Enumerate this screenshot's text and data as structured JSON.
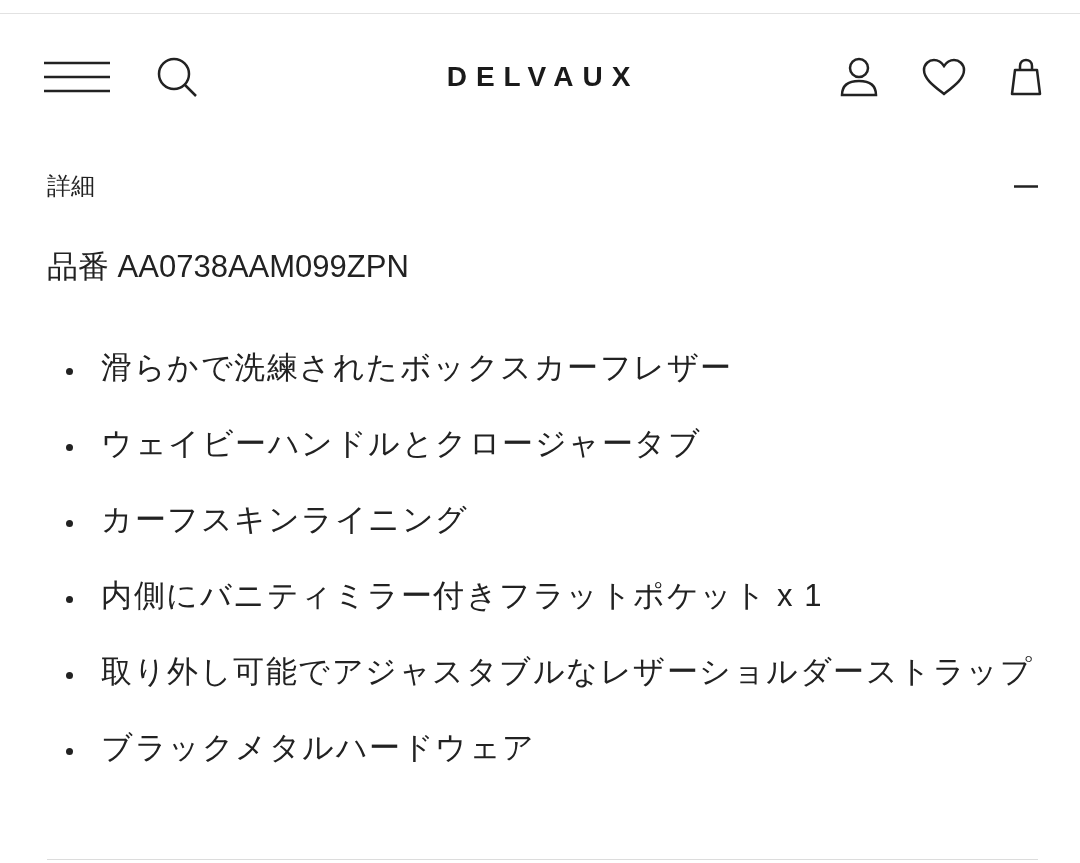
{
  "header": {
    "logo": "DELVAUX"
  },
  "section": {
    "title": "詳細",
    "expanded": true,
    "product_code": "品番 AA0738AAM099ZPN",
    "features": [
      "滑らかで洗練されたボックスカーフレザー",
      "ウェイビーハンドルとクロージャータブ",
      "カーフスキンライニング",
      "内側にバニティミラー付きフラットポケット x 1",
      "取り外し可能でアジャスタブルなレザーショルダーストラップ",
      "ブラックメタルハードウェア"
    ]
  }
}
